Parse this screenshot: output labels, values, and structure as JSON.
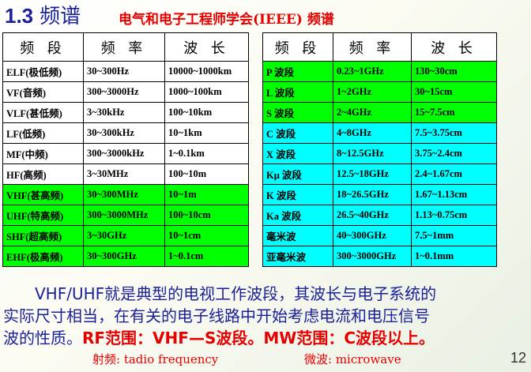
{
  "header": {
    "title_number": "1.3",
    "title_text": "频谱",
    "subtitle": "电气和电子工程师学会(IEEE) 频谱"
  },
  "left_table": {
    "headers": [
      "频 段",
      "频 率",
      "波 长"
    ],
    "rows": [
      {
        "band": "ELF(极低频)",
        "freq": "30~300Hz",
        "wave": "10000~1000km",
        "color": "white"
      },
      {
        "band": "VF(音频)",
        "freq": "300~3000Hz",
        "wave": "1000~100km",
        "color": "white"
      },
      {
        "band": "VLF(甚低频)",
        "freq": "3~30kHz",
        "wave": "100~10km",
        "color": "white"
      },
      {
        "band": "LF(低频)",
        "freq": "30~300kHz",
        "wave": "10~1km",
        "color": "white"
      },
      {
        "band": "MF(中频)",
        "freq": "300~3000kHz",
        "wave": "1~0.1km",
        "color": "white"
      },
      {
        "band": "HF(高频)",
        "freq": "3~30MHz",
        "wave": "100~10m",
        "color": "white"
      },
      {
        "band": "VHF(甚高频)",
        "freq": "30~300MHz",
        "wave": "10~1m",
        "color": "green"
      },
      {
        "band": "UHF(特高频)",
        "freq": "300~3000MHz",
        "wave": "100~10cm",
        "color": "green"
      },
      {
        "band": "SHF(超高频)",
        "freq": "3~30GHz",
        "wave": "10~1cm",
        "color": "green"
      },
      {
        "band": "EHF(极高频)",
        "freq": "30~300GHz",
        "wave": "1~0.1cm",
        "color": "green"
      }
    ]
  },
  "right_table": {
    "headers": [
      "频 段",
      "频 率",
      "波 长"
    ],
    "rows": [
      {
        "band": "P 波段",
        "freq": "0.23~1GHz",
        "wave": "130~30cm",
        "color": "green"
      },
      {
        "band": "L 波段",
        "freq": "1~2GHz",
        "wave": "30~15cm",
        "color": "green"
      },
      {
        "band": "S 波段",
        "freq": "2~4GHz",
        "wave": "15~7.5cm",
        "color": "green"
      },
      {
        "band": "C 波段",
        "freq": "4~8GHz",
        "wave": "7.5~3.75cm",
        "color": "cyan"
      },
      {
        "band": "X 波段",
        "freq": "8~12.5GHz",
        "wave": "3.75~2.4cm",
        "color": "cyan"
      },
      {
        "band": "Kμ 波段",
        "freq": "12.5~18GHz",
        "wave": "2.4~1.67cm",
        "color": "cyan"
      },
      {
        "band": "K 波段",
        "freq": "18~26.5GHz",
        "wave": "1.67~1.13cm",
        "color": "cyan"
      },
      {
        "band": "Ka 波段",
        "freq": "26.5~40GHz",
        "wave": "1.13~0.75cm",
        "color": "cyan"
      },
      {
        "band": "毫米波",
        "freq": "40~300GHz",
        "wave": "7.5~1mm",
        "color": "cyan"
      },
      {
        "band": "亚毫米波",
        "freq": "300~3000GHz",
        "wave": "1~0.1mm",
        "color": "cyan"
      }
    ]
  },
  "paragraph": {
    "line1": "VHF/UHF就是典型的电视工作波段，其波长与电子系统的",
    "line2": "实际尺寸相当，在有关的电子线路中开始考虑电流和电压信号",
    "line3_prefix": "波的性质。",
    "rf_label": "RF范围：VHF—S波段。",
    "mw_label": "MW范围：C波段以上。"
  },
  "labels": {
    "rf": "射频: tadio  frequency",
    "mw": "微波: microwave"
  },
  "page_number": "12",
  "colors": {
    "green": "#00ff00",
    "cyan": "#00ffff",
    "title_blue": "#1a1f9a",
    "accent_red": "#e60000"
  }
}
